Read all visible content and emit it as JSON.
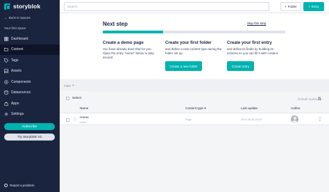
{
  "brand": {
    "name": "storyblok"
  },
  "sidebar": {
    "back_label": "Back to spaces",
    "space_name": "Your first space",
    "items": [
      {
        "label": "Dashboard",
        "icon": "dashboard-icon"
      },
      {
        "label": "Content",
        "icon": "folder-icon"
      },
      {
        "label": "Tags",
        "icon": "tag-icon"
      },
      {
        "label": "Assets",
        "icon": "image-icon"
      },
      {
        "label": "Components",
        "icon": "components-icon"
      },
      {
        "label": "Datasources",
        "icon": "database-icon"
      },
      {
        "label": "Apps",
        "icon": "apps-icon"
      },
      {
        "label": "Settings",
        "icon": "gear-icon"
      }
    ],
    "subscribe_label": "Subscribe",
    "try_label": "Try Storyblok V2",
    "report_label": "Report a problem"
  },
  "topbar": {
    "search_placeholder": "Search",
    "folder_label": "Folder",
    "entry_label": "Entry"
  },
  "onboarding": {
    "title": "Next step",
    "skip_label": "Skip this step",
    "progress": 0.33,
    "steps": [
      {
        "title": "Create a demo page",
        "desc": "You have already done that for you. Open the entry \"Home\" below to play around."
      },
      {
        "title": "Create your first folder",
        "desc": "and define a new content type during the folder set up.",
        "button": "Create a new folder"
      },
      {
        "title": "Create your first entry",
        "desc": "and define its fields by building its schema so you can fill it with content.",
        "button": "Create entry"
      }
    ]
  },
  "list": {
    "filter_label": "Filter",
    "select_label": "Select",
    "sorting_label": "Default sorting",
    "columns": {
      "name": "Name",
      "content_type": "Content type",
      "last_update": "Last update",
      "author": "Author"
    },
    "rows": [
      {
        "name": "Home",
        "slug": "home",
        "content_type": "Page",
        "last_update": "2019-05-28 15:23"
      }
    ]
  },
  "colors": {
    "sidebar": "#1b243f",
    "accent": "#00b3b0",
    "background": "#eef0f3"
  }
}
